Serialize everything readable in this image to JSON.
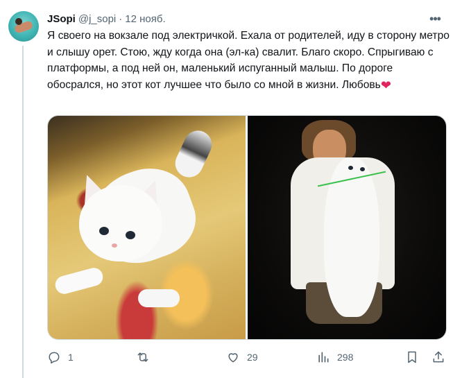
{
  "post": {
    "author_name": "JSopi",
    "author_handle": "@j_sopi",
    "separator": "·",
    "date": "12 нояб.",
    "more_label": "•••",
    "text": "Я своего на вокзале под электричкой. Ехала от родителей, иду в сторону метро и слышу орет. Стою, жду когда она (эл-ка) свалит. Благо скоро. Спрыгиваю с платформы, а под ней он, маленький испуганный малыш. По дороге обосрался, но этот кот лучшее что было со мной в жизни. Любовь",
    "emoji": "❤"
  },
  "metrics": {
    "replies": "1",
    "reposts": "",
    "likes": "29",
    "views": "298"
  },
  "colors": {
    "text_primary": "#0f1419",
    "text_secondary": "#536471",
    "border": "#cfd9de",
    "heart": "#e0245e"
  },
  "icons": {
    "reply": "reply-icon",
    "repost": "repost-icon",
    "like": "heart-icon",
    "views": "views-icon",
    "bookmark": "bookmark-icon",
    "share": "share-icon",
    "more": "more-icon"
  }
}
